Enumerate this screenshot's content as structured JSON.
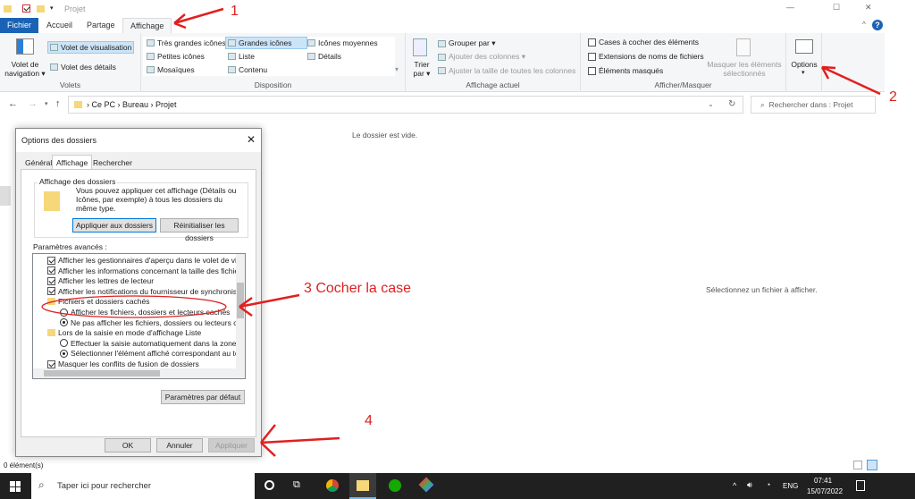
{
  "window": {
    "title": "Projet",
    "minimize": "—",
    "maximize": "☐",
    "close": "✕",
    "help": "?"
  },
  "tabs": [
    {
      "label": "Fichier"
    },
    {
      "label": "Accueil"
    },
    {
      "label": "Partage"
    },
    {
      "label": "Affichage",
      "active": true
    }
  ],
  "ribbon": {
    "volets": {
      "label": "Volets",
      "nav": "Volet de navigation ▾",
      "preview": "Volet de visualisation",
      "details": "Volet des détails"
    },
    "disposition": {
      "label": "Disposition",
      "items": [
        "Très grandes icônes",
        "Grandes icônes",
        "Icônes moyennes",
        "Petites icônes",
        "Liste",
        "Détails",
        "Mosaïques",
        "Contenu"
      ],
      "selected": "Grandes icônes"
    },
    "affichage": {
      "label": "Affichage actuel",
      "sort": "Trier par ▾",
      "group": "Grouper par ▾",
      "addcols": "Ajouter des colonnes ▾",
      "fitcols": "Ajuster la taille de toutes les colonnes"
    },
    "afficher": {
      "label": "Afficher/Masquer",
      "checkboxes": [
        {
          "label": "Cases à cocher des éléments",
          "checked": false
        },
        {
          "label": "Extensions de noms de fichiers",
          "checked": false
        },
        {
          "label": "Éléments masqués",
          "checked": false
        }
      ],
      "hide": "Masquer les éléments sélectionnés"
    },
    "options": {
      "label": "Options",
      "arrow": "▾"
    }
  },
  "address": {
    "path": [
      "Ce PC",
      "Bureau",
      "Projet"
    ],
    "search_placeholder": "Rechercher dans : Projet"
  },
  "main": {
    "empty": "Le dossier est vide.",
    "preview": "Sélectionnez un fichier à afficher."
  },
  "dialog": {
    "title": "Options des dossiers",
    "tabs": [
      "Général",
      "Affichage",
      "Rechercher"
    ],
    "group_title": "Affichage des dossiers",
    "group_text": "Vous pouvez appliquer cet affichage (Détails ou Icônes, par exemple) à tous les dossiers du même type.",
    "apply_folders": "Appliquer aux dossiers",
    "reset_folders": "Réinitialiser les dossiers",
    "advanced_label": "Paramètres avancés :",
    "items": [
      {
        "type": "check",
        "checked": true,
        "label": "Afficher les gestionnaires d'aperçu dans le volet de visual"
      },
      {
        "type": "check",
        "checked": true,
        "label": "Afficher les informations concernant la taille des fichiers d"
      },
      {
        "type": "check",
        "checked": true,
        "label": "Afficher les lettres de lecteur"
      },
      {
        "type": "check",
        "checked": true,
        "label": "Afficher les notifications du fournisseur de synchronisation"
      },
      {
        "type": "folder",
        "label": "Fichiers et dossiers cachés"
      },
      {
        "type": "radio",
        "checked": false,
        "label": "Afficher les fichiers, dossiers et lecteurs cachés"
      },
      {
        "type": "radio",
        "checked": true,
        "label": "Ne pas afficher les fichiers, dossiers ou lecteurs cach"
      },
      {
        "type": "folder",
        "label": "Lors de la saisie en mode d'affichage Liste"
      },
      {
        "type": "radio",
        "checked": false,
        "label": "Effectuer la saisie automatiquement dans la zone Rec"
      },
      {
        "type": "radio",
        "checked": true,
        "label": "Sélectionner l'élément affiché correspondant au texte"
      },
      {
        "type": "check",
        "checked": true,
        "label": "Masquer les conflits de fusion de dossiers"
      }
    ],
    "defaults": "Paramètres par défaut",
    "ok": "OK",
    "cancel": "Annuler",
    "apply": "Appliquer"
  },
  "annotations": {
    "a1": "1",
    "a2": "2",
    "a3": "3 Cocher la case",
    "a4": "4",
    "color": "#e02020"
  },
  "status": {
    "count": "0 élément(s)"
  },
  "taskbar": {
    "search": "Taper ici pour rechercher",
    "lang": "ENG",
    "time": "07:41",
    "date": "15/07/2022"
  }
}
